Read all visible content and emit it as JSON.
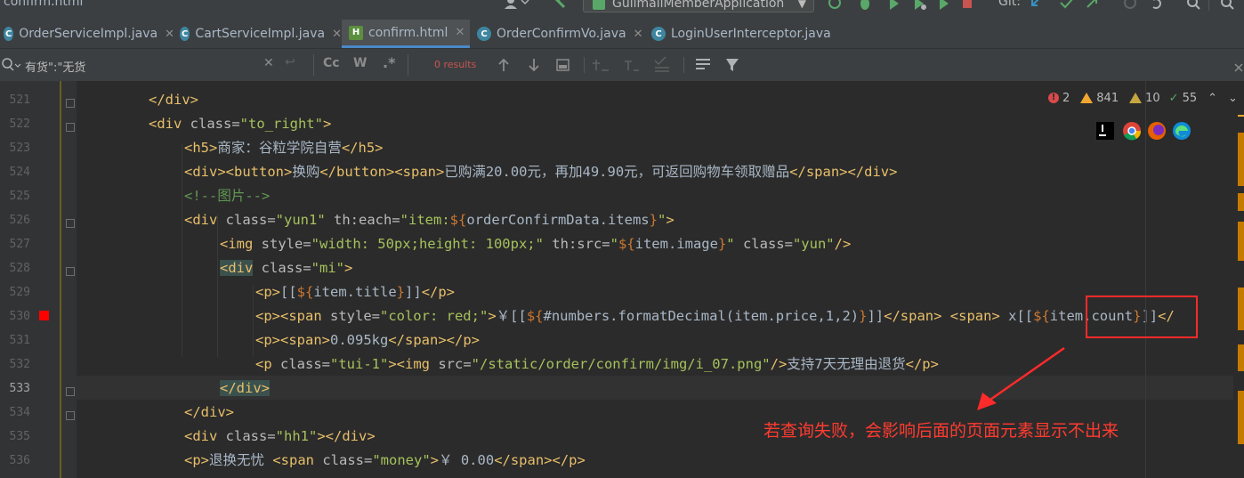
{
  "top": {
    "file_partial": "confirm.html",
    "run_config": "GulimallMemberApplication",
    "git_label": "Git:"
  },
  "tabs": [
    {
      "label": "OrderServiceImpl.java",
      "icon": "c"
    },
    {
      "label": "CartServiceImpl.java",
      "icon": "c"
    },
    {
      "label": "confirm.html",
      "icon": "h"
    },
    {
      "label": "OrderConfirmVo.java",
      "icon": "c"
    },
    {
      "label": "LoginUserInterceptor.java",
      "icon": "c"
    }
  ],
  "find": {
    "query": "有货\":\"无货",
    "results": "0 results",
    "cc": "Cc",
    "w": "W",
    "regex": ".*"
  },
  "inspections": {
    "errors": "2",
    "warnings": "841",
    "weak_warnings": "10",
    "ok": "55"
  },
  "lines": [
    "521",
    "522",
    "523",
    "524",
    "525",
    "526",
    "527",
    "528",
    "529",
    "530",
    "531",
    "532",
    "533",
    "534",
    "535",
    "536"
  ],
  "code": {
    "l521": "</div>",
    "l522a": "<div",
    "l522b": " class=",
    "l522c": "\"to_right\"",
    "l522d": ">",
    "l523a": "<h5>",
    "l523b": "商家：谷粒学院自营",
    "l523c": "</h5>",
    "l524a": "<div><button>",
    "l524b": "换购",
    "l524c": "</button><span>",
    "l524d": "已购满20.00元，再加49.90元，可返回购物车领取赠品",
    "l524e": "</span></div>",
    "l525": "<!--图片-->",
    "l526a": "<div",
    "l526b": " class=",
    "l526c": "\"yun1\"",
    "l526d": " th:each=",
    "l526e": "\"item:",
    "l526f": "${",
    "l526g": "orderConfirmData.items",
    "l526h": "}",
    "l526i": "\"",
    "l526j": ">",
    "l527a": "<img",
    "l527b": " style=",
    "l527c": "\"width: 50px;height: 100px;\"",
    "l527d": " th:src=",
    "l527e": "\"",
    "l527f": "${",
    "l527g": "item.image",
    "l527h": "}",
    "l527i": "\"",
    "l527j": " class=",
    "l527k": "\"yun\"",
    "l527l": "/>",
    "l528a": "<div",
    "l528b": " class=",
    "l528c": "\"mi\"",
    "l528d": ">",
    "l529a": "<p>",
    "l529b": "[[",
    "l529c": "${",
    "l529d": "item.title",
    "l529e": "}",
    "l529f": "]]",
    "l529g": "</p>",
    "l530a": "<p><span",
    "l530b": " style=",
    "l530c": "\"color: red;\"",
    "l530d": ">",
    "l530e": "￥[[",
    "l530f": "${",
    "l530g": "#numbers.formatDecimal(item.price,1,2)",
    "l530h": "}",
    "l530i": "]]",
    "l530j": "</span>",
    "l530k": " ",
    "l530l": "<span>",
    "l530m": " x[[",
    "l530n": "${",
    "l530o": "item.count",
    "l530p": "}",
    "l530q": "]]",
    "l530r": "</",
    "l531a": "<p><span>",
    "l531b": "0.095kg",
    "l531c": "</span></p>",
    "l532a": "<p",
    "l532b": " class=",
    "l532c": "\"tui-1\"",
    "l532d": "><img",
    "l532e": " src=",
    "l532f": "\"/static/order/confirm/img/i_07.png\"",
    "l532g": "/>",
    "l532h": "支持7天无理由退货",
    "l532i": "</p>",
    "l533": "</div>",
    "l534": "</div>",
    "l535a": "<div",
    "l535b": " class=",
    "l535c": "\"hh1\"",
    "l535d": "></div>",
    "l536a": "<p>",
    "l536b": "退换无忧 ",
    "l536c": "<span",
    "l536d": " class=",
    "l536e": "\"money\"",
    "l536f": ">",
    "l536g": "￥ 0.00",
    "l536h": "</span></p>"
  },
  "annotation": {
    "text": "若查询失败，会影响后面的页面元素显示不出来",
    "color": "#ff3b30"
  }
}
